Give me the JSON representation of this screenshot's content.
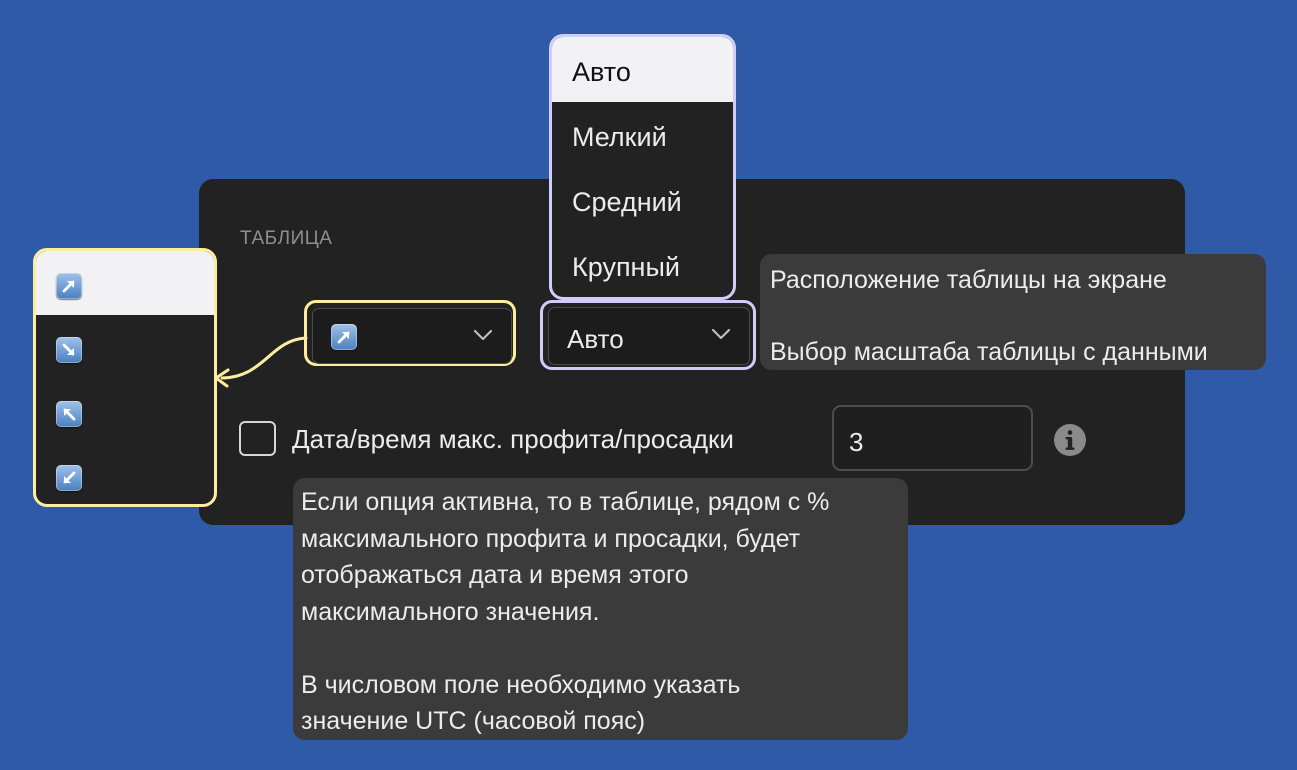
{
  "section": {
    "title": "ТАБЛИЦА"
  },
  "position_select": {
    "icon": "arrow-up-right-icon",
    "options": [
      {
        "icon": "arrow-up-right-icon"
      },
      {
        "icon": "arrow-down-right-icon"
      },
      {
        "icon": "arrow-up-left-icon"
      },
      {
        "icon": "arrow-down-left-icon"
      }
    ],
    "selected_index": 0
  },
  "scale_select": {
    "value": "Авто",
    "options": [
      "Авто",
      "Мелкий",
      "Средний",
      "Крупный"
    ],
    "selected_index": 0
  },
  "tooltip_right": {
    "line1": "Расположение таблицы на экране",
    "line2": "Выбор масштаба таблицы с данными"
  },
  "checkbox": {
    "label": "Дата/время макс. профита/просадки",
    "checked": false
  },
  "number_input": {
    "value": "3"
  },
  "tooltip_bottom": {
    "text": "Если опция активна, то в таблице, рядом с %\nмаксимального профита и просадки, будет\nотображаться дата и время этого\nмаксимального значения.\n\nВ числовом поле необходимо указать\nзначение UTC (часовой пояс)"
  },
  "colors": {
    "background": "#2f5aa8",
    "panel": "#222222",
    "highlight_yellow": "#fcee9e",
    "highlight_purple": "#d0cdfb",
    "tooltip": "#3b3b3b"
  }
}
